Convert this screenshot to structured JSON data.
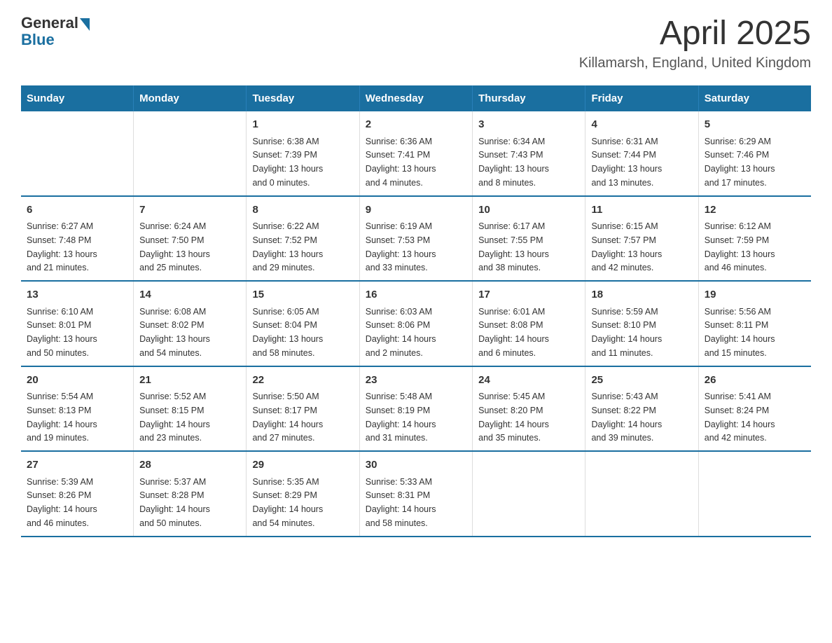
{
  "header": {
    "logo_general": "General",
    "logo_blue": "Blue",
    "title": "April 2025",
    "subtitle": "Killamarsh, England, United Kingdom"
  },
  "weekdays": [
    "Sunday",
    "Monday",
    "Tuesday",
    "Wednesday",
    "Thursday",
    "Friday",
    "Saturday"
  ],
  "weeks": [
    [
      {
        "day": "",
        "info": ""
      },
      {
        "day": "",
        "info": ""
      },
      {
        "day": "1",
        "info": "Sunrise: 6:38 AM\nSunset: 7:39 PM\nDaylight: 13 hours\nand 0 minutes."
      },
      {
        "day": "2",
        "info": "Sunrise: 6:36 AM\nSunset: 7:41 PM\nDaylight: 13 hours\nand 4 minutes."
      },
      {
        "day": "3",
        "info": "Sunrise: 6:34 AM\nSunset: 7:43 PM\nDaylight: 13 hours\nand 8 minutes."
      },
      {
        "day": "4",
        "info": "Sunrise: 6:31 AM\nSunset: 7:44 PM\nDaylight: 13 hours\nand 13 minutes."
      },
      {
        "day": "5",
        "info": "Sunrise: 6:29 AM\nSunset: 7:46 PM\nDaylight: 13 hours\nand 17 minutes."
      }
    ],
    [
      {
        "day": "6",
        "info": "Sunrise: 6:27 AM\nSunset: 7:48 PM\nDaylight: 13 hours\nand 21 minutes."
      },
      {
        "day": "7",
        "info": "Sunrise: 6:24 AM\nSunset: 7:50 PM\nDaylight: 13 hours\nand 25 minutes."
      },
      {
        "day": "8",
        "info": "Sunrise: 6:22 AM\nSunset: 7:52 PM\nDaylight: 13 hours\nand 29 minutes."
      },
      {
        "day": "9",
        "info": "Sunrise: 6:19 AM\nSunset: 7:53 PM\nDaylight: 13 hours\nand 33 minutes."
      },
      {
        "day": "10",
        "info": "Sunrise: 6:17 AM\nSunset: 7:55 PM\nDaylight: 13 hours\nand 38 minutes."
      },
      {
        "day": "11",
        "info": "Sunrise: 6:15 AM\nSunset: 7:57 PM\nDaylight: 13 hours\nand 42 minutes."
      },
      {
        "day": "12",
        "info": "Sunrise: 6:12 AM\nSunset: 7:59 PM\nDaylight: 13 hours\nand 46 minutes."
      }
    ],
    [
      {
        "day": "13",
        "info": "Sunrise: 6:10 AM\nSunset: 8:01 PM\nDaylight: 13 hours\nand 50 minutes."
      },
      {
        "day": "14",
        "info": "Sunrise: 6:08 AM\nSunset: 8:02 PM\nDaylight: 13 hours\nand 54 minutes."
      },
      {
        "day": "15",
        "info": "Sunrise: 6:05 AM\nSunset: 8:04 PM\nDaylight: 13 hours\nand 58 minutes."
      },
      {
        "day": "16",
        "info": "Sunrise: 6:03 AM\nSunset: 8:06 PM\nDaylight: 14 hours\nand 2 minutes."
      },
      {
        "day": "17",
        "info": "Sunrise: 6:01 AM\nSunset: 8:08 PM\nDaylight: 14 hours\nand 6 minutes."
      },
      {
        "day": "18",
        "info": "Sunrise: 5:59 AM\nSunset: 8:10 PM\nDaylight: 14 hours\nand 11 minutes."
      },
      {
        "day": "19",
        "info": "Sunrise: 5:56 AM\nSunset: 8:11 PM\nDaylight: 14 hours\nand 15 minutes."
      }
    ],
    [
      {
        "day": "20",
        "info": "Sunrise: 5:54 AM\nSunset: 8:13 PM\nDaylight: 14 hours\nand 19 minutes."
      },
      {
        "day": "21",
        "info": "Sunrise: 5:52 AM\nSunset: 8:15 PM\nDaylight: 14 hours\nand 23 minutes."
      },
      {
        "day": "22",
        "info": "Sunrise: 5:50 AM\nSunset: 8:17 PM\nDaylight: 14 hours\nand 27 minutes."
      },
      {
        "day": "23",
        "info": "Sunrise: 5:48 AM\nSunset: 8:19 PM\nDaylight: 14 hours\nand 31 minutes."
      },
      {
        "day": "24",
        "info": "Sunrise: 5:45 AM\nSunset: 8:20 PM\nDaylight: 14 hours\nand 35 minutes."
      },
      {
        "day": "25",
        "info": "Sunrise: 5:43 AM\nSunset: 8:22 PM\nDaylight: 14 hours\nand 39 minutes."
      },
      {
        "day": "26",
        "info": "Sunrise: 5:41 AM\nSunset: 8:24 PM\nDaylight: 14 hours\nand 42 minutes."
      }
    ],
    [
      {
        "day": "27",
        "info": "Sunrise: 5:39 AM\nSunset: 8:26 PM\nDaylight: 14 hours\nand 46 minutes."
      },
      {
        "day": "28",
        "info": "Sunrise: 5:37 AM\nSunset: 8:28 PM\nDaylight: 14 hours\nand 50 minutes."
      },
      {
        "day": "29",
        "info": "Sunrise: 5:35 AM\nSunset: 8:29 PM\nDaylight: 14 hours\nand 54 minutes."
      },
      {
        "day": "30",
        "info": "Sunrise: 5:33 AM\nSunset: 8:31 PM\nDaylight: 14 hours\nand 58 minutes."
      },
      {
        "day": "",
        "info": ""
      },
      {
        "day": "",
        "info": ""
      },
      {
        "day": "",
        "info": ""
      }
    ]
  ]
}
